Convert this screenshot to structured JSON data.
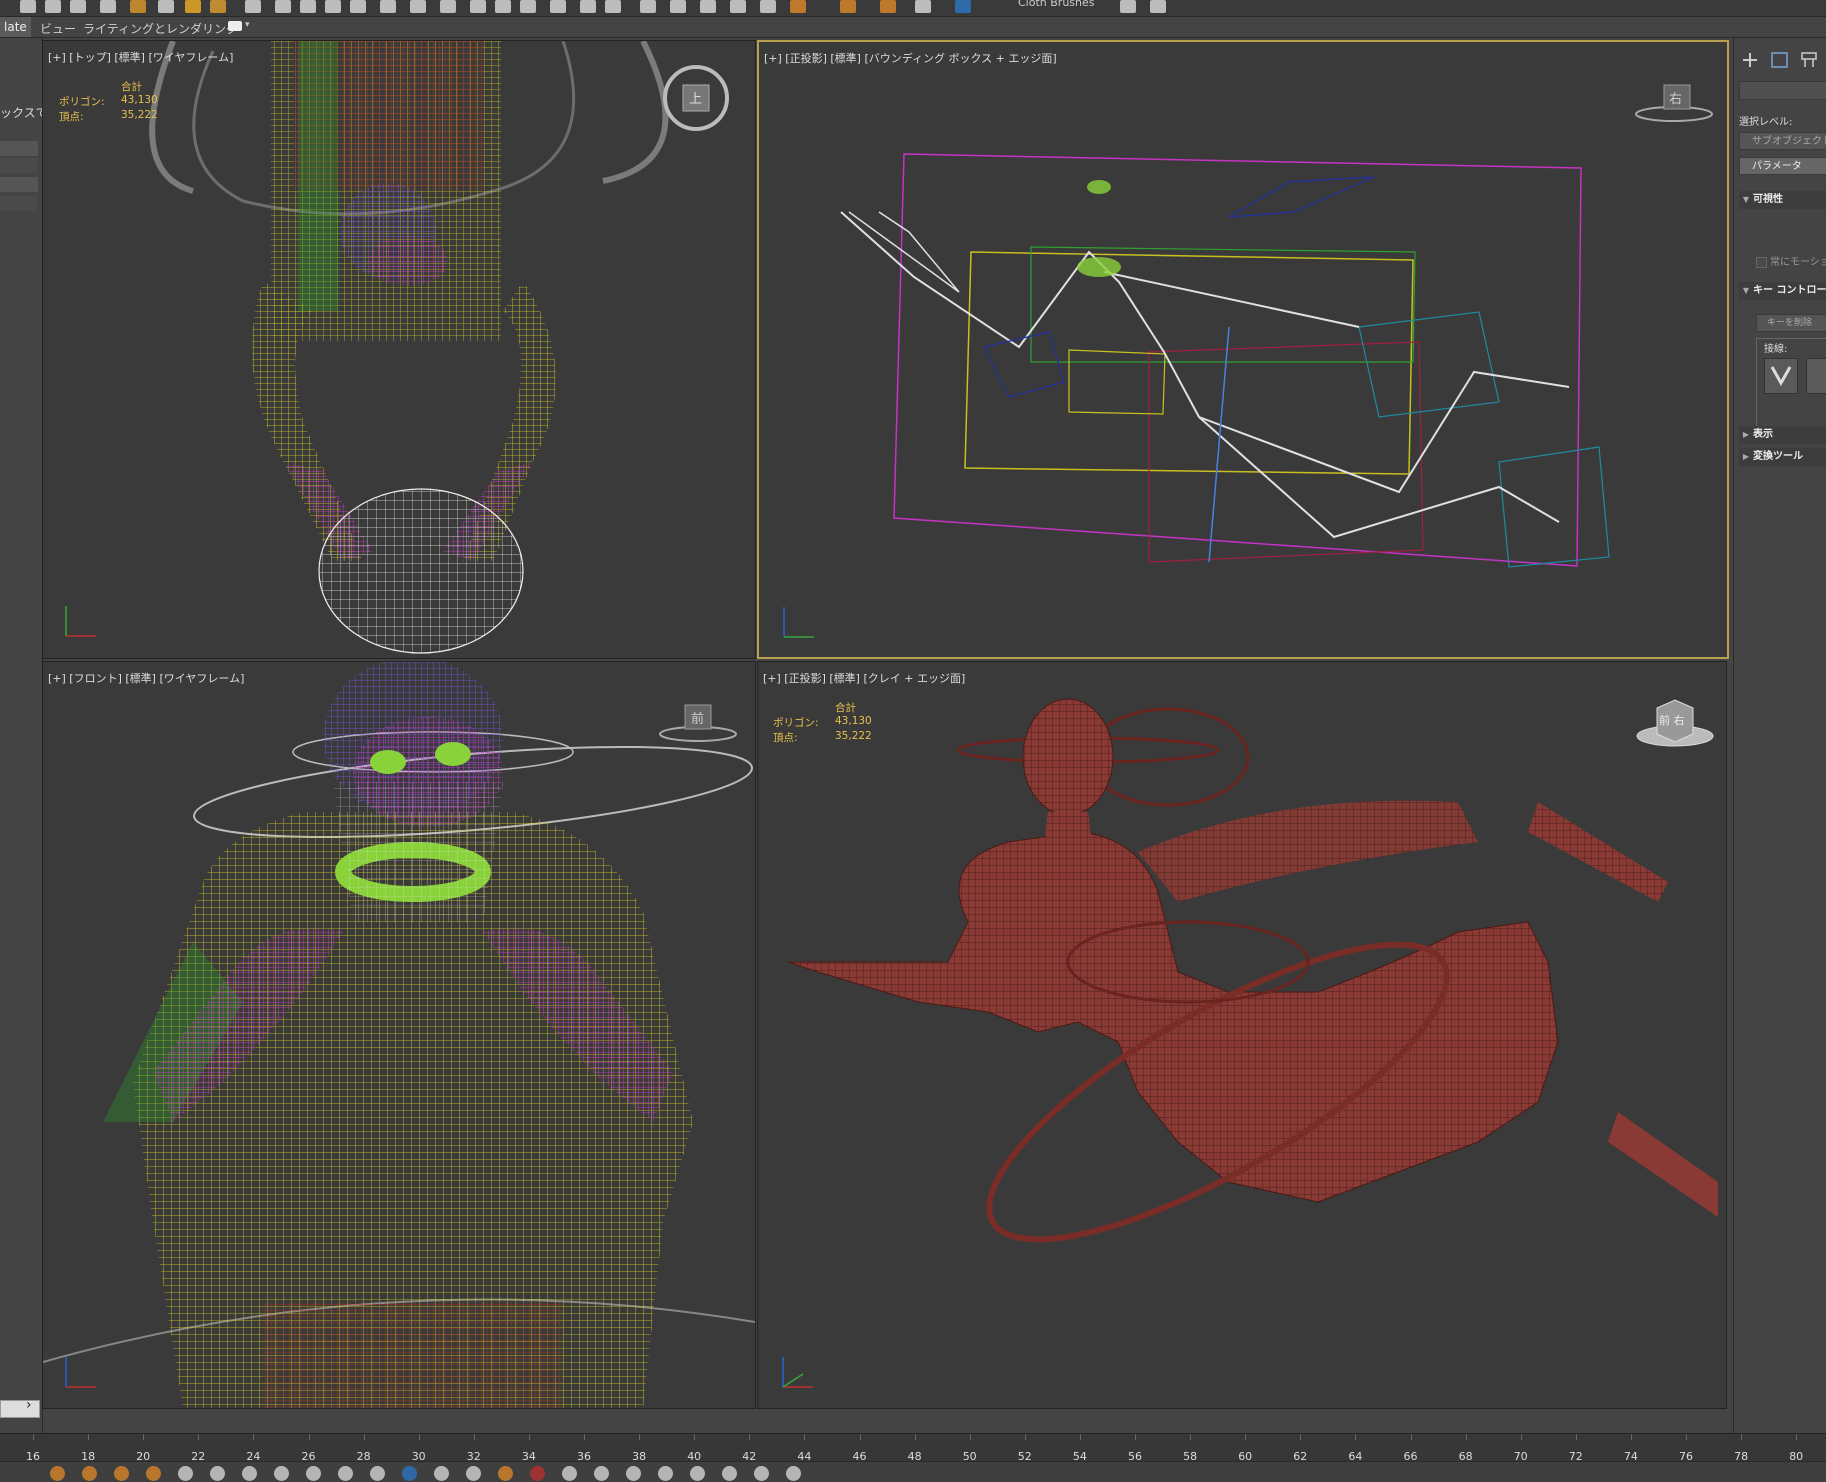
{
  "toolbar": {
    "cloth_label": "Cloth Brushes",
    "icons": [
      "undo-icon",
      "redo-icon",
      "link-icon",
      "unlink-icon",
      "bind-space-warp-icon",
      "select-filter-icon",
      "select-object-icon",
      "select-by-name-icon",
      "select-region-icon",
      "window-crossing-icon",
      "move-icon",
      "rotate-icon",
      "scale-icon",
      "reference-coordinate-icon",
      "pivot-icon",
      "snap-icon",
      "angle-snap-icon",
      "percent-snap-icon",
      "spinner-snap-icon",
      "named-selection-icon",
      "mirror-icon",
      "align-icon",
      "layer-icon",
      "scene-explorer-icon",
      "curve-editor-icon",
      "schematic-view-icon",
      "material-editor-icon",
      "render-setup-icon",
      "rendered-frame-icon",
      "render-icon",
      "arnold-icon",
      "hammer-icon",
      "list-icon",
      "list-icon-2"
    ]
  },
  "menubar": {
    "items": [
      "late",
      "ビュー",
      "ライティングとレンダリング"
    ],
    "dropdown_icon": "monitor-dropdown-icon"
  },
  "left_strip": {
    "cut_label": "ックスで表:"
  },
  "viewports": {
    "top": {
      "label": "[+] [トップ] [標準] [ワイヤフレーム]",
      "stats": {
        "title": "合計",
        "polygons_label": "ポリゴン:",
        "polygons": "43,130",
        "vertices_label": "頂点:",
        "vertices": "35,222"
      },
      "cube_label": "上"
    },
    "right": {
      "label": "[+] [正投影] [標準] [バウンディング ボックス + エッジ面]",
      "cube_label": "右"
    },
    "front": {
      "label": "[+] [フロント] [標準] [ワイヤフレーム]",
      "cube_label": "前"
    },
    "persp": {
      "label": "[+] [正投影] [標準] [クレイ + エッジ面]",
      "stats": {
        "title": "合計",
        "polygons_label": "ポリゴン:",
        "polygons": "43,130",
        "vertices_label": "頂点:",
        "vertices": "35,222"
      },
      "cube_label": "前 右"
    }
  },
  "command_panel": {
    "selection_level_label": "選択レベル:",
    "sub_object_button": "サブオブジェクト",
    "parameters_button": "パラメータ",
    "visibility_rollout": "可視性",
    "always_on_motion": "常にモーション",
    "key_controls_rollout": "キー コントロー",
    "delete_key_button": "キーを削除",
    "tangent_label": "接線:",
    "display_rollout": "表示",
    "transform_tools_rollout": "変換ツール"
  },
  "timeline": {
    "ticks": [
      "16",
      "18",
      "20",
      "22",
      "24",
      "26",
      "28",
      "30",
      "32",
      "34",
      "36",
      "38",
      "40",
      "42",
      "44",
      "46",
      "48",
      "50",
      "52",
      "54",
      "56",
      "58",
      "60",
      "62",
      "64",
      "66",
      "68",
      "70",
      "72",
      "74",
      "76",
      "78",
      "80"
    ]
  },
  "colors": {
    "accent_active": "#b7a050",
    "stats_text": "#e6c14c",
    "viewport_bg": "#3a3a3a",
    "clay": "#8a3a34"
  }
}
